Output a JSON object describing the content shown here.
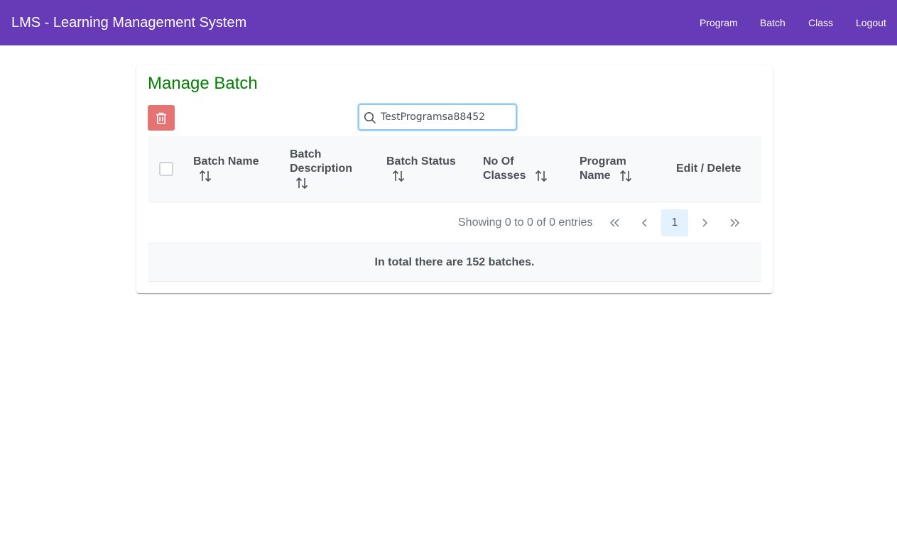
{
  "header": {
    "app_title": "LMS - Learning Management System",
    "nav": [
      "Program",
      "Batch",
      "Class",
      "Logout"
    ],
    "bg_color": "#673ab7"
  },
  "page": {
    "title": "Manage Batch",
    "title_color": "#008000",
    "delete_icon": "trash-icon",
    "search": {
      "value": "TestProgramsa88452",
      "icon": "search-icon"
    }
  },
  "table": {
    "columns": [
      {
        "line1": "Batch Name",
        "line2": ""
      },
      {
        "line1": "Batch",
        "line2": "Description"
      },
      {
        "line1": "Batch Status",
        "line2": ""
      },
      {
        "line1": "No Of",
        "line2": "Classes"
      },
      {
        "line1": "Program",
        "line2": "Name"
      },
      {
        "line1": "Edit / Delete",
        "line2": ""
      }
    ],
    "rows": []
  },
  "paginator": {
    "summary": "Showing 0 to 0 of 0 entries",
    "current_page": "1",
    "icons": [
      "first-page-icon",
      "prev-page-icon",
      "next-page-icon",
      "last-page-icon"
    ]
  },
  "footer": {
    "text": "In total there are 152 batches."
  }
}
